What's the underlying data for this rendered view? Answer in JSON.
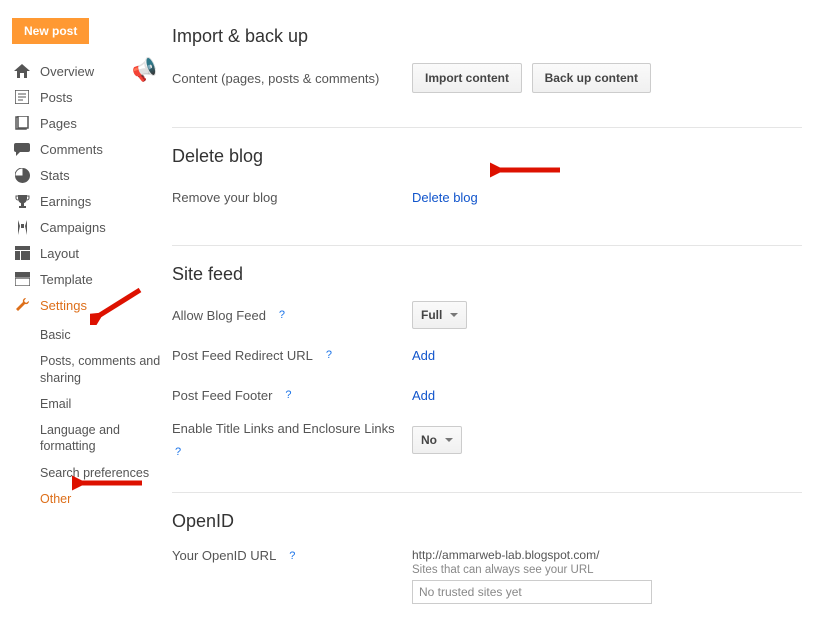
{
  "sidebar": {
    "new_post": "New post",
    "items": [
      {
        "label": "Overview"
      },
      {
        "label": "Posts"
      },
      {
        "label": "Pages"
      },
      {
        "label": "Comments"
      },
      {
        "label": "Stats"
      },
      {
        "label": "Earnings"
      },
      {
        "label": "Campaigns"
      },
      {
        "label": "Layout"
      },
      {
        "label": "Template"
      },
      {
        "label": "Settings"
      }
    ],
    "settings_sub": [
      {
        "label": "Basic"
      },
      {
        "label": "Posts, comments and sharing"
      },
      {
        "label": "Email"
      },
      {
        "label": "Language and formatting"
      },
      {
        "label": "Search preferences"
      },
      {
        "label": "Other"
      }
    ]
  },
  "import": {
    "heading": "Import & back up",
    "desc": "Content (pages, posts & comments)",
    "btn_import": "Import content",
    "btn_backup": "Back up content"
  },
  "delete": {
    "heading": "Delete blog",
    "desc": "Remove your blog",
    "link": "Delete blog"
  },
  "sitefeed": {
    "heading": "Site feed",
    "allow_label": "Allow Blog Feed",
    "allow_value": "Full",
    "redirect_label": "Post Feed Redirect URL",
    "redirect_value": "Add",
    "footer_label": "Post Feed Footer",
    "footer_value": "Add",
    "enclosure_label": "Enable Title Links and Enclosure Links",
    "enclosure_value": "No"
  },
  "openid": {
    "heading": "OpenID",
    "label": "Your OpenID URL",
    "url": "http://ammarweb-lab.blogspot.com/",
    "sub": "Sites that can always see your URL",
    "trusted": "No trusted sites yet"
  }
}
